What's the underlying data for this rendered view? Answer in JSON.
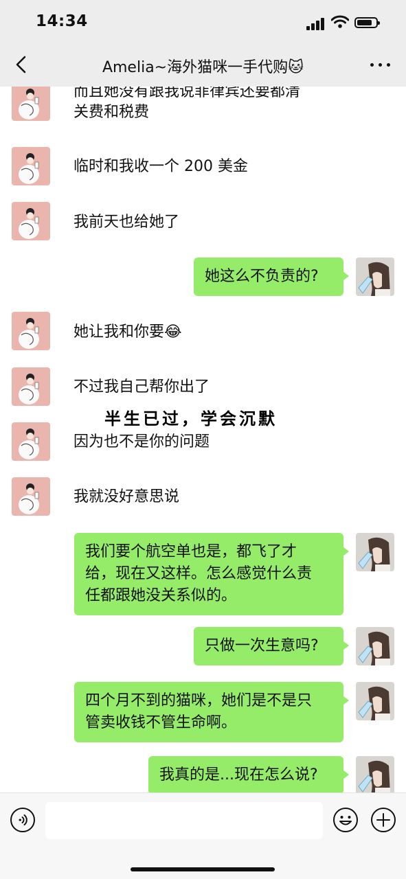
{
  "status_bar": {
    "time": "14:34",
    "battery_level": 0.8
  },
  "header": {
    "title": "Amelia~海外猫咪一手代购🐱",
    "back_icon": "chevron-left-icon",
    "more_icon": "ellipsis-icon"
  },
  "watermark": "半生已过，学会沉默",
  "messages": [
    {
      "side": "left",
      "text": "而且她没有跟我说菲律宾还要都清"
    },
    {
      "side": "left",
      "text": "关费和税费"
    },
    {
      "side": "left",
      "text": "临时和我收一个 200 美金"
    },
    {
      "side": "left",
      "text": "我前天也给她了"
    },
    {
      "side": "right",
      "text": "她这么不负责的?"
    },
    {
      "side": "left",
      "text": "她让我和你要😂"
    },
    {
      "side": "left",
      "text": "不过我自己帮你出了"
    },
    {
      "side": "left",
      "text": "因为也不是你的问题"
    },
    {
      "side": "left",
      "text": "我就没好意思说"
    },
    {
      "side": "right",
      "lines": [
        "我们要个航空单也是，都飞了才",
        "给，现在又这样。怎么感觉什么责",
        "任都跟她没关系似的。"
      ]
    },
    {
      "side": "right",
      "text": "只做一次生意吗?"
    },
    {
      "side": "right",
      "lines": [
        "四个月不到的猫咪，她们是不是只",
        "管卖收钱不管生命啊。"
      ]
    },
    {
      "side": "right",
      "text": "我真的是...现在怎么说?"
    }
  ],
  "input_bar": {
    "voice_icon": "voice-icon",
    "emoji_icon": "emoji-icon",
    "plus_icon": "plus-icon"
  },
  "colors": {
    "sent_bubble": "#95ec69",
    "bar_bg": "#ededed",
    "chat_bg": "#ffffff"
  }
}
